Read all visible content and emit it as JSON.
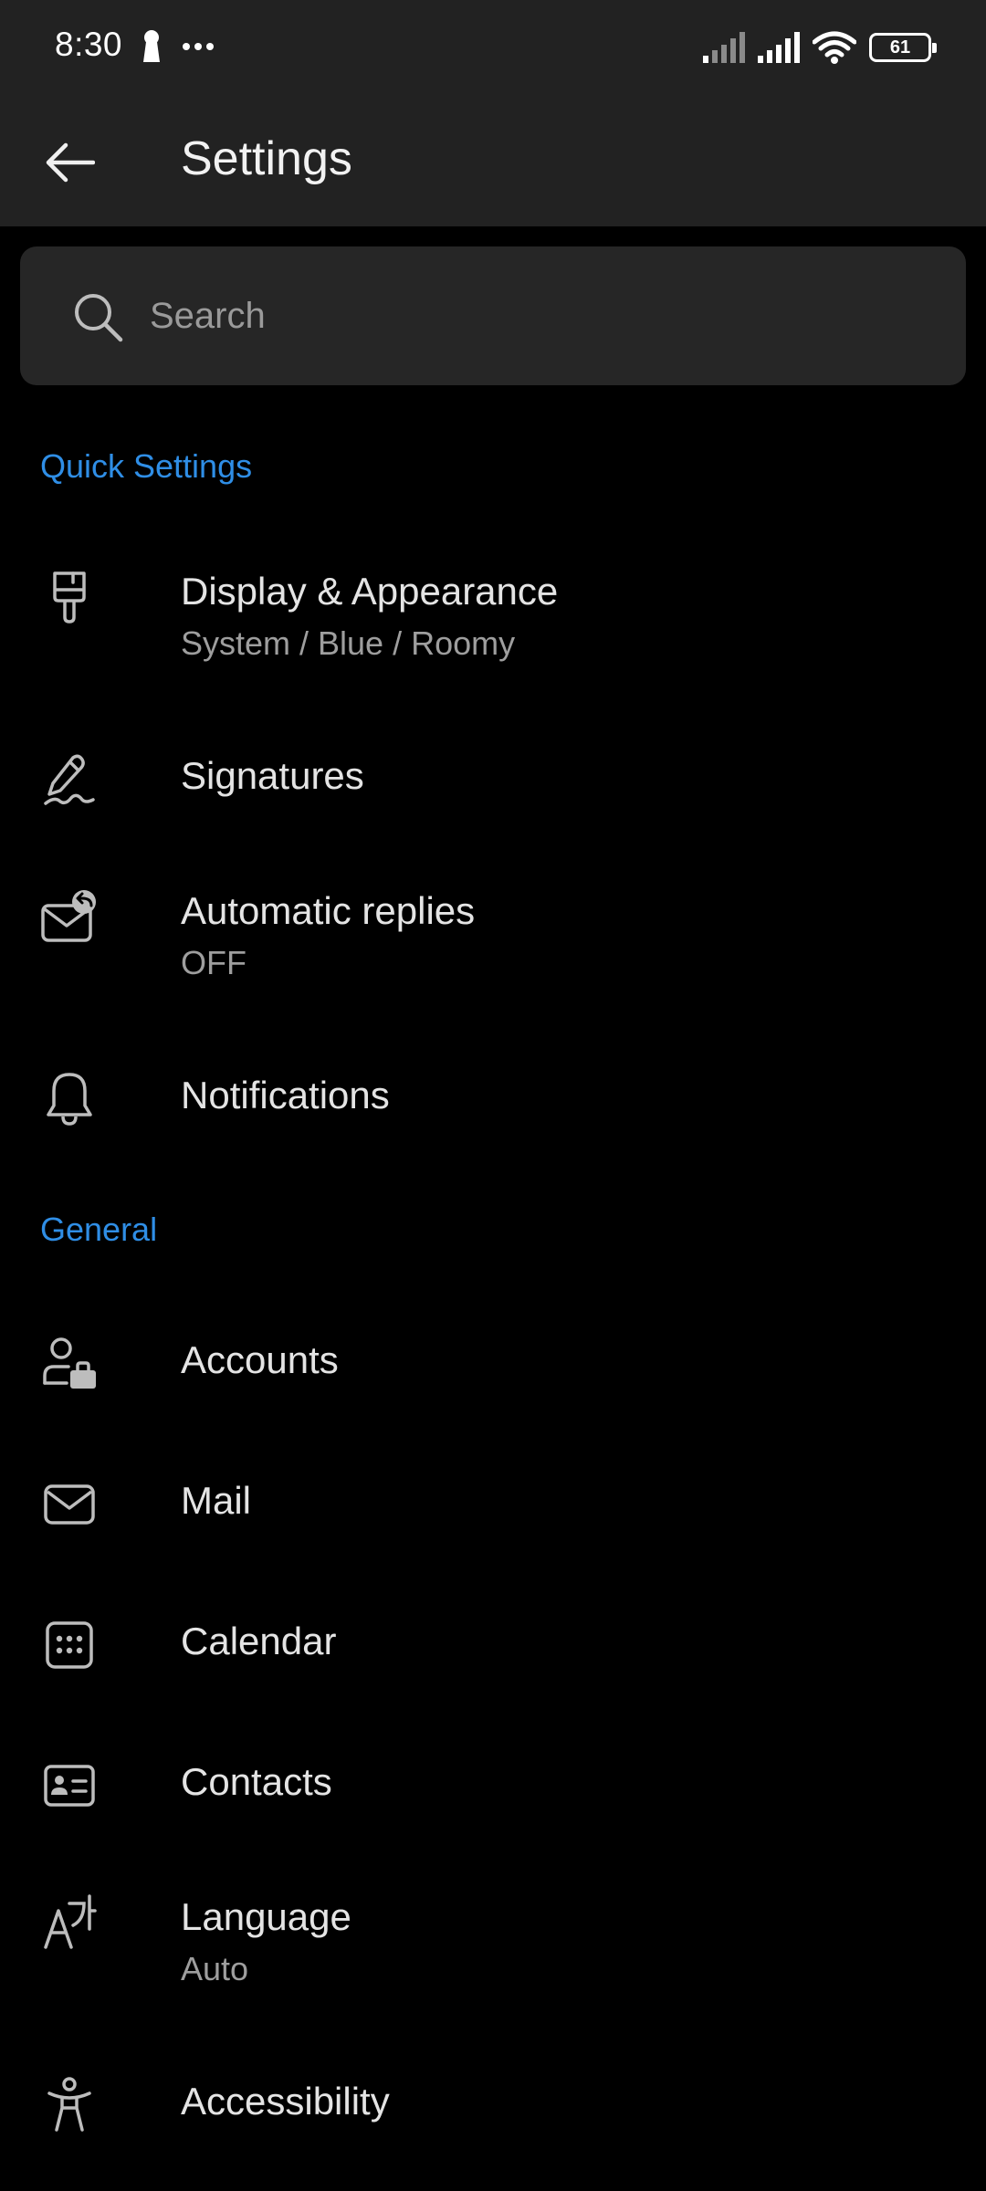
{
  "status_bar": {
    "time": "8:30",
    "battery": "61",
    "battery_level": 61
  },
  "header": {
    "title": "Settings",
    "back_icon": "arrow-left-icon"
  },
  "search": {
    "placeholder": "Search",
    "value": ""
  },
  "sections": [
    {
      "title": "Quick Settings",
      "items": [
        {
          "label": "Display & Appearance",
          "subtitle": "System / Blue / Roomy",
          "icon": "paintbrush-icon"
        },
        {
          "label": "Signatures",
          "subtitle": "",
          "icon": "signature-pen-icon"
        },
        {
          "label": "Automatic replies",
          "subtitle": "OFF",
          "icon": "mail-reply-icon"
        },
        {
          "label": "Notifications",
          "subtitle": "",
          "icon": "bell-icon"
        }
      ]
    },
    {
      "title": "General",
      "items": [
        {
          "label": "Accounts",
          "subtitle": "",
          "icon": "person-briefcase-icon"
        },
        {
          "label": "Mail",
          "subtitle": "",
          "icon": "envelope-icon"
        },
        {
          "label": "Calendar",
          "subtitle": "",
          "icon": "calendar-icon"
        },
        {
          "label": "Contacts",
          "subtitle": "",
          "icon": "contact-card-icon"
        },
        {
          "label": "Language",
          "subtitle": "Auto",
          "icon": "language-icon"
        },
        {
          "label": "Accessibility",
          "subtitle": "",
          "icon": "accessibility-icon"
        }
      ]
    }
  ],
  "colors": {
    "accent": "#2f8ee6",
    "background": "#000000",
    "bar": "#222222",
    "search_bg": "#262626"
  }
}
